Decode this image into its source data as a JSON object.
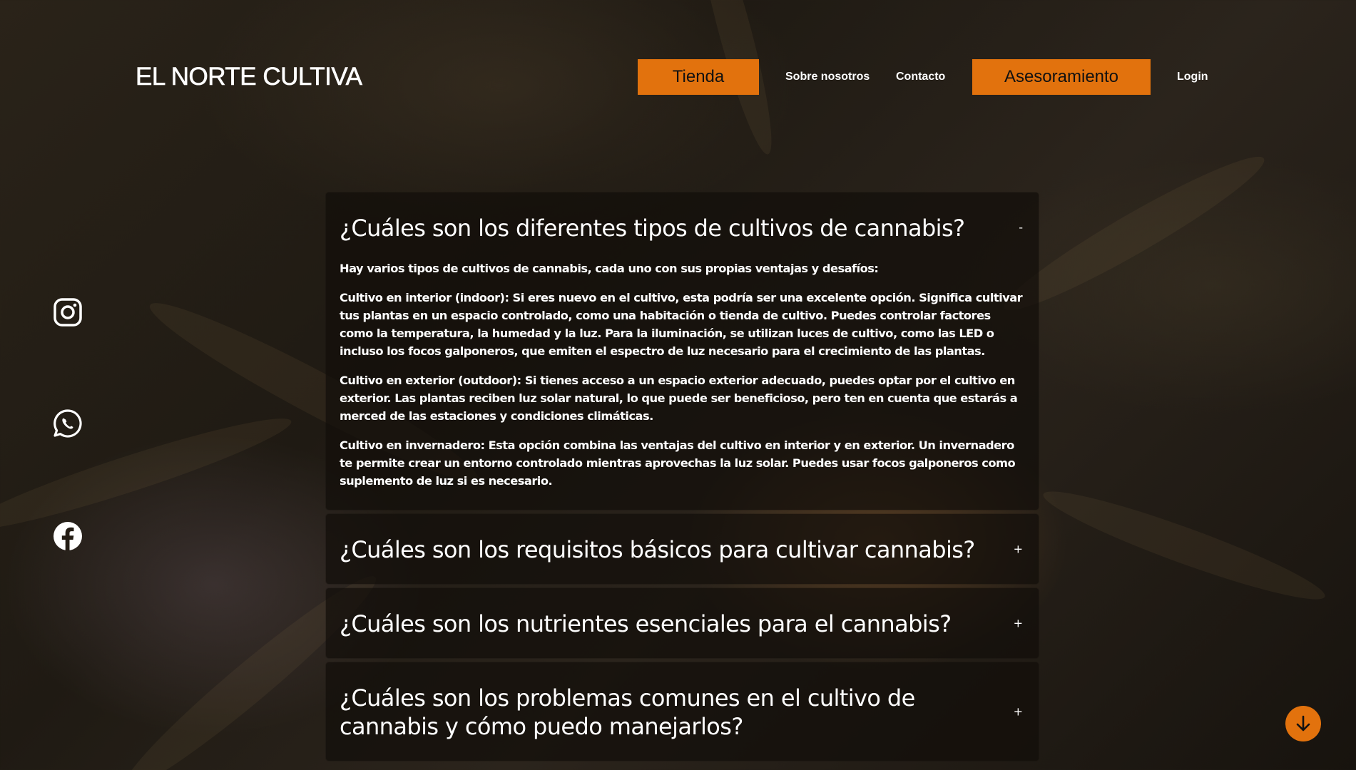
{
  "header": {
    "brand": "EL NORTE CULTIVA",
    "nav": {
      "tienda": "Tienda",
      "sobre_nosotros": "Sobre nosotros",
      "contacto": "Contacto",
      "asesoramiento": "Asesoramiento",
      "login": "Login"
    }
  },
  "social": {
    "instagram": "instagram-icon",
    "whatsapp": "whatsapp-icon",
    "facebook": "facebook-icon"
  },
  "faq": {
    "items": [
      {
        "title": "¿Cuáles son los diferentes tipos de cultivos de cannabis?",
        "toggle": "-",
        "paragraphs": [
          "Hay varios tipos de cultivos de cannabis, cada uno con sus propias ventajas y desafíos:",
          "Cultivo en interior (indoor): Si eres nuevo en el cultivo, esta podría ser una excelente opción. Significa cultivar tus plantas en un espacio controlado, como una habitación o tienda de cultivo. Puedes controlar factores como la temperatura, la humedad y la luz. Para la iluminación, se utilizan luces de cultivo, como las LED o incluso los focos galponeros, que emiten el espectro de luz necesario para el crecimiento de las plantas.",
          "Cultivo en exterior (outdoor): Si tienes acceso a un espacio exterior adecuado, puedes optar por el cultivo en exterior. Las plantas reciben luz solar natural, lo que puede ser beneficioso, pero ten en cuenta que estarás a merced de las estaciones y condiciones climáticas.",
          "Cultivo en invernadero: Esta opción combina las ventajas del cultivo en interior y en exterior. Un invernadero te permite crear un entorno controlado mientras aprovechas la luz solar. Puedes usar focos galponeros como suplemento de luz si es necesario."
        ]
      },
      {
        "title": "¿Cuáles son los requisitos básicos para cultivar cannabis?",
        "toggle": "+"
      },
      {
        "title": "¿Cuáles son los nutrientes esenciales para el cannabis?",
        "toggle": "+"
      },
      {
        "title": "¿Cuáles son los problemas comunes en el cultivo de cannabis y cómo puedo manejarlos?",
        "toggle": "+"
      }
    ]
  },
  "colors": {
    "accent": "#e2720d",
    "panel": "#120e0a"
  },
  "scroll_button": "arrow-down-icon"
}
